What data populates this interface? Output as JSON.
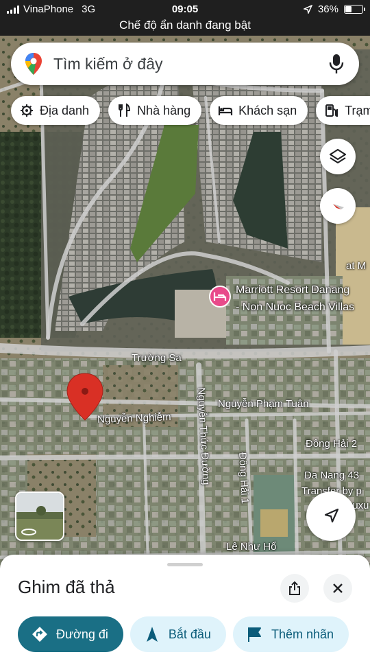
{
  "status_bar": {
    "carrier": "VinaPhone",
    "network": "3G",
    "time": "09:05",
    "battery_percent": "36%",
    "battery_level": 0.36,
    "incognito_text": "Chế độ ẩn danh đang bật"
  },
  "search": {
    "placeholder": "Tìm kiếm ở đây",
    "logo_icon": "google-maps-pin-icon",
    "voice_icon": "microphone-icon"
  },
  "chips": [
    {
      "label": "Địa danh",
      "icon": "landmark-icon"
    },
    {
      "label": "Nhà hàng",
      "icon": "restaurant-icon"
    },
    {
      "label": "Khách sạn",
      "icon": "hotel-icon"
    },
    {
      "label": "Trạm",
      "icon": "gas-station-icon"
    }
  ],
  "map": {
    "labels": {
      "marriott_line1": "Marriott Resort Danang",
      "marriott_line2": "- Non Nuoc Beach Villas",
      "truong_sa": "Trường Sa",
      "nguyen_nghiem": "Nguyễn Nghiễm",
      "nguyen_thuc_duong": "Nguyễn Thức Đường",
      "nguyen_pham_tuan": "Nguyễn Phạm Tuân",
      "dong_hai_2": "Đông Hải 2",
      "dong_hai_1": "Đông Hải 1",
      "da_nang_43": "Da Nang 43",
      "transfer": "Transfer by p",
      "le_nhu_ho": "Lê Như Hổ",
      "at_m": "at M",
      "luxu": "Luxu"
    },
    "layers_icon": "layers-icon",
    "compass_icon": "compass-icon",
    "location_icon": "navigation-arrow-icon",
    "street_view_icon": "street-view-rotate-icon"
  },
  "sheet": {
    "title": "Ghim đã thả",
    "share_icon": "share-icon",
    "close_icon": "close-icon",
    "actions": [
      {
        "label": "Đường đi",
        "icon": "directions-icon"
      },
      {
        "label": "Bắt đầu",
        "icon": "navigation-start-icon"
      },
      {
        "label": "Thêm nhãn",
        "icon": "label-flag-icon"
      }
    ]
  },
  "colors": {
    "primary_action": "#1a6f85",
    "secondary_action_bg": "#dff3fb",
    "pin": "#d93025",
    "hotel_pin": "#e84a8a"
  }
}
